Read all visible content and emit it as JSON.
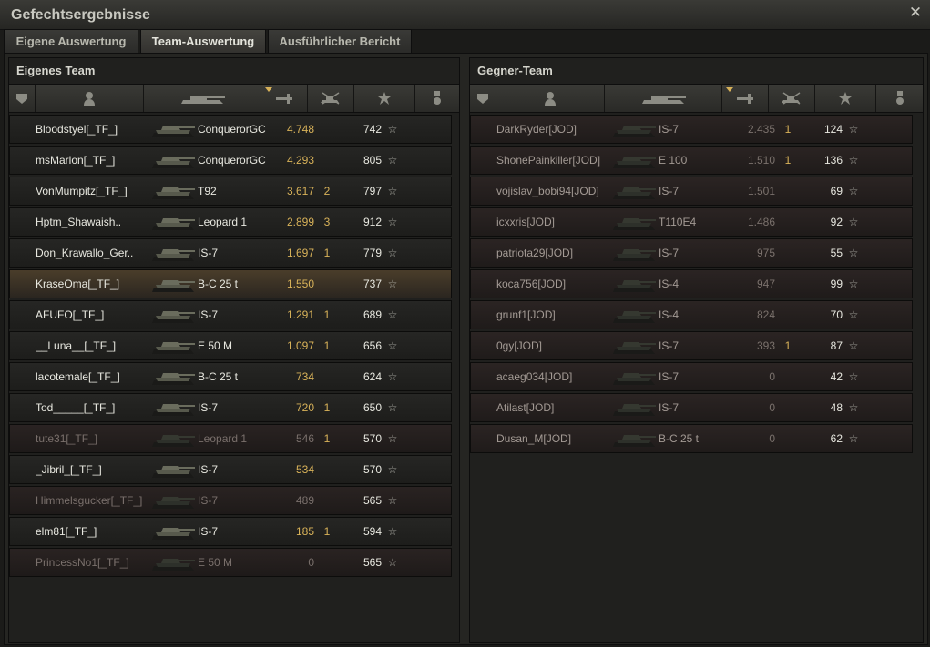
{
  "window": {
    "title": "Gefechtsergebnisse",
    "close_icon": "close-icon"
  },
  "tabs": [
    {
      "label": "Eigene Auswertung"
    },
    {
      "label": "Team-Auswertung"
    },
    {
      "label": "Ausführlicher Bericht"
    }
  ],
  "active_tab": 1,
  "own_team": {
    "title": "Eigenes Team",
    "rows": [
      {
        "name": "Bloodstyel[_TF_]",
        "tank": "ConquerorGC",
        "damage": "4.748",
        "frags": "",
        "xp": "742",
        "state": "normal"
      },
      {
        "name": "msMarlon[_TF_]",
        "tank": "ConquerorGC",
        "damage": "4.293",
        "frags": "",
        "xp": "805",
        "state": "normal"
      },
      {
        "name": "VonMumpitz[_TF_]",
        "tank": "T92",
        "damage": "3.617",
        "frags": "2",
        "xp": "797",
        "state": "normal"
      },
      {
        "name": "Hptm_Shawaish..",
        "tank": "Leopard 1",
        "damage": "2.899",
        "frags": "3",
        "xp": "912",
        "state": "normal"
      },
      {
        "name": "Don_Krawallo_Ger..",
        "tank": "IS-7",
        "damage": "1.697",
        "frags": "1",
        "xp": "779",
        "state": "normal"
      },
      {
        "name": "KraseOma[_TF_]",
        "tank": "B-C 25 t",
        "damage": "1.550",
        "frags": "",
        "xp": "737",
        "state": "highlight"
      },
      {
        "name": "AFUFO[_TF_]",
        "tank": "IS-7",
        "damage": "1.291",
        "frags": "1",
        "xp": "689",
        "state": "normal"
      },
      {
        "name": "__Luna__[_TF_]",
        "tank": "E 50 M",
        "damage": "1.097",
        "frags": "1",
        "xp": "656",
        "state": "normal"
      },
      {
        "name": "lacotemale[_TF_]",
        "tank": "B-C 25 t",
        "damage": "734",
        "frags": "",
        "xp": "624",
        "state": "normal"
      },
      {
        "name": "Tod_____[_TF_]",
        "tank": "IS-7",
        "damage": "720",
        "frags": "1",
        "xp": "650",
        "state": "normal"
      },
      {
        "name": "tute31[_TF_]",
        "tank": "Leopard 1",
        "damage": "546",
        "frags": "1",
        "xp": "570",
        "state": "dead"
      },
      {
        "name": "_Jibril_[_TF_]",
        "tank": "IS-7",
        "damage": "534",
        "frags": "",
        "xp": "570",
        "state": "normal"
      },
      {
        "name": "Himmelsgucker[_TF_]",
        "tank": "IS-7",
        "damage": "489",
        "frags": "",
        "xp": "565",
        "state": "dead"
      },
      {
        "name": "elm81[_TF_]",
        "tank": "IS-7",
        "damage": "185",
        "frags": "1",
        "xp": "594",
        "state": "normal"
      },
      {
        "name": "PrincessNo1[_TF_]",
        "tank": "E 50 M",
        "damage": "0",
        "frags": "",
        "xp": "565",
        "state": "dead"
      }
    ]
  },
  "enemy_team": {
    "title": "Gegner-Team",
    "rows": [
      {
        "name": "DarkRyder[JOD]",
        "tank": "IS-7",
        "damage": "2.435",
        "frags": "1",
        "xp": "124"
      },
      {
        "name": "ShonePainkiller[JOD]",
        "tank": "E 100",
        "damage": "1.510",
        "frags": "1",
        "xp": "136"
      },
      {
        "name": "vojislav_bobi94[JOD]",
        "tank": "IS-7",
        "damage": "1.501",
        "frags": "",
        "xp": "69"
      },
      {
        "name": "icxxris[JOD]",
        "tank": "T110E4",
        "damage": "1.486",
        "frags": "",
        "xp": "92"
      },
      {
        "name": "patriota29[JOD]",
        "tank": "IS-7",
        "damage": "975",
        "frags": "",
        "xp": "55"
      },
      {
        "name": "koca756[JOD]",
        "tank": "IS-4",
        "damage": "947",
        "frags": "",
        "xp": "99"
      },
      {
        "name": "grunf1[JOD]",
        "tank": "IS-4",
        "damage": "824",
        "frags": "",
        "xp": "70"
      },
      {
        "name": "0gy[JOD]",
        "tank": "IS-7",
        "damage": "393",
        "frags": "1",
        "xp": "87"
      },
      {
        "name": "acaeg034[JOD]",
        "tank": "IS-7",
        "damage": "0",
        "frags": "",
        "xp": "42"
      },
      {
        "name": "Atilast[JOD]",
        "tank": "IS-7",
        "damage": "0",
        "frags": "",
        "xp": "48"
      },
      {
        "name": "Dusan_M[JOD]",
        "tank": "B-C 25 t",
        "damage": "0",
        "frags": "",
        "xp": "62"
      }
    ]
  },
  "columns": [
    {
      "icon": "squad-icon"
    },
    {
      "icon": "player-icon"
    },
    {
      "icon": "tank-icon"
    },
    {
      "icon": "damage-icon",
      "sorted": true
    },
    {
      "icon": "kills-icon"
    },
    {
      "icon": "xp-star-icon"
    },
    {
      "icon": "medal-icon"
    }
  ],
  "colors": {
    "accent": "#d8b259",
    "text": "#e8e8e0",
    "dead_text": "#7a706c",
    "highlight_row": "#4a3d2a"
  }
}
